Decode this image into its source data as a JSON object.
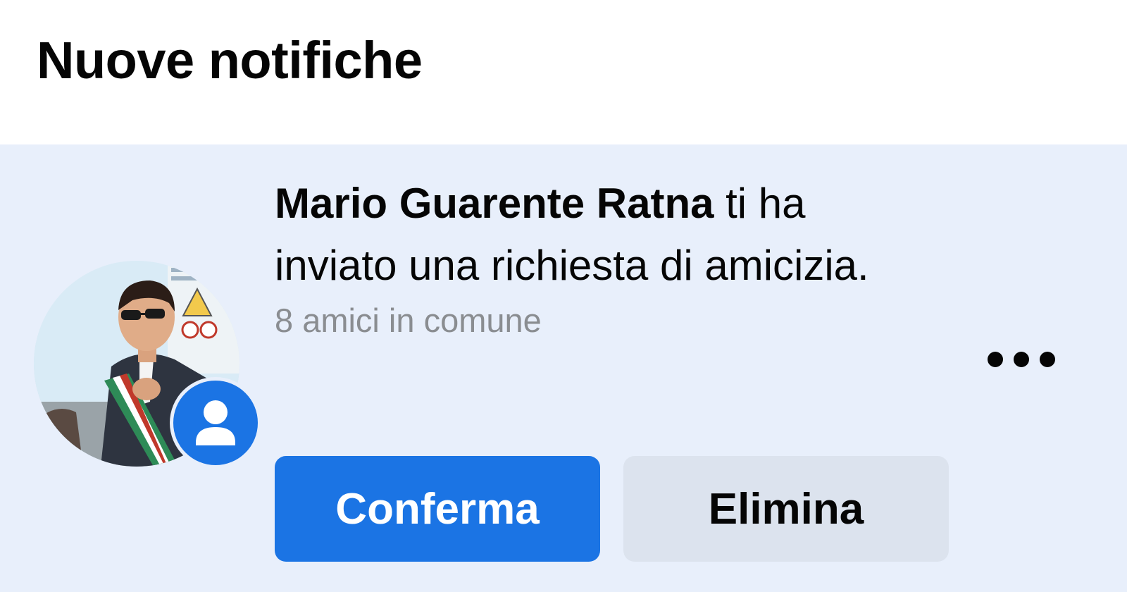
{
  "header": {
    "title": "Nuove notifiche"
  },
  "notification": {
    "sender_name": "Mario Guarente Ratna",
    "message_rest": " ti ha inviato una richiesta di amicizia.",
    "mutual_friends": "8 amici in comune",
    "badge_icon": "person-icon",
    "more_icon": "more-options-icon",
    "confirm_label": "Conferma",
    "delete_label": "Elimina"
  },
  "colors": {
    "accent": "#1b74e4",
    "card_background": "#e8effb",
    "secondary_button": "#dce3ee",
    "muted_text": "#8a8d91"
  }
}
